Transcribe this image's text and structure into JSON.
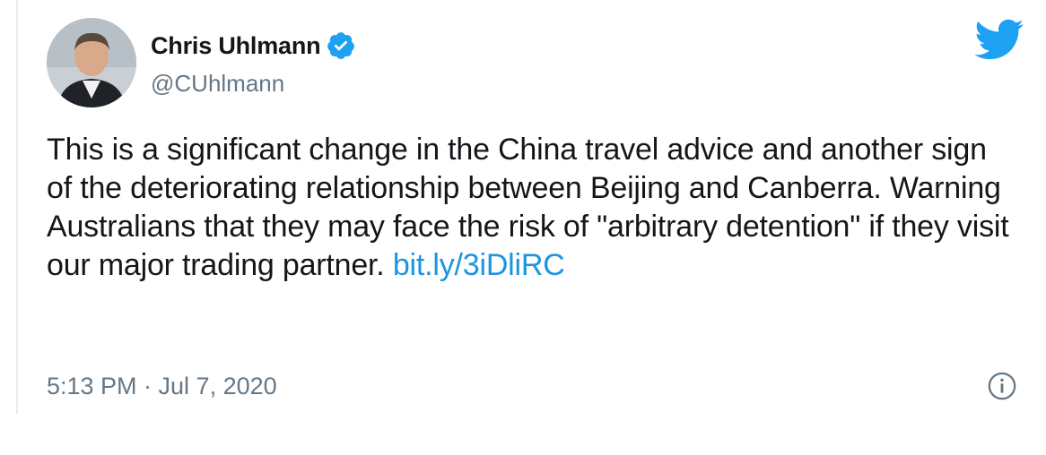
{
  "tweet": {
    "author": {
      "name": "Chris Uhlmann",
      "handle": "@CUhlmann",
      "verified": true
    },
    "text_parts": [
      "This is a significant change in the China travel advice and another sign of the deteriorating relationship between Beijing and Canberra. Warning Australians that they may face the risk of \"arbitrary detention\" if they visit our major trading partner. "
    ],
    "link": "bit.ly/3iDliRC",
    "timestamp": "5:13 PM · Jul 7, 2020"
  },
  "icons": {
    "brand": "twitter-bird-icon",
    "verified": "verified-badge-icon",
    "info": "info-icon"
  },
  "colors": {
    "twitter_blue": "#1da1f2",
    "link": "#1b95e0",
    "secondary_text": "#657786"
  }
}
